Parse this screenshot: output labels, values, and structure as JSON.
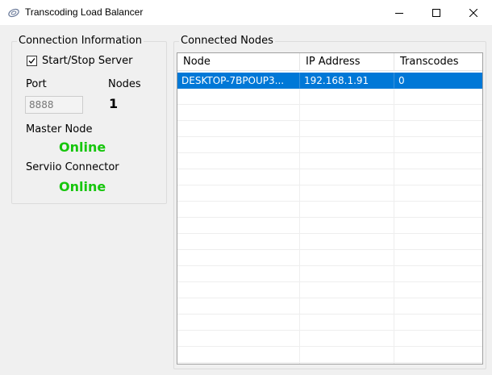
{
  "window": {
    "title": "Transcoding Load Balancer"
  },
  "colors": {
    "online": "#16c60c",
    "selection": "#0078d7"
  },
  "connection": {
    "group_label": "Connection Information",
    "start_stop_label": "Start/Stop Server",
    "start_stop_checked": true,
    "port_label": "Port",
    "port_value": "8888",
    "nodes_label": "Nodes",
    "nodes_count": "1",
    "master_label": "Master Node",
    "master_status": "Online",
    "serviio_label": "Serviio Connector",
    "serviio_status": "Online"
  },
  "nodes": {
    "group_label": "Connected Nodes",
    "columns": [
      "Node",
      "IP Address",
      "Transcodes"
    ],
    "rows": [
      {
        "node": "DESKTOP-7BPOUP3...",
        "ip": "192.168.1.91",
        "transcodes": "0",
        "selected": true
      }
    ]
  }
}
